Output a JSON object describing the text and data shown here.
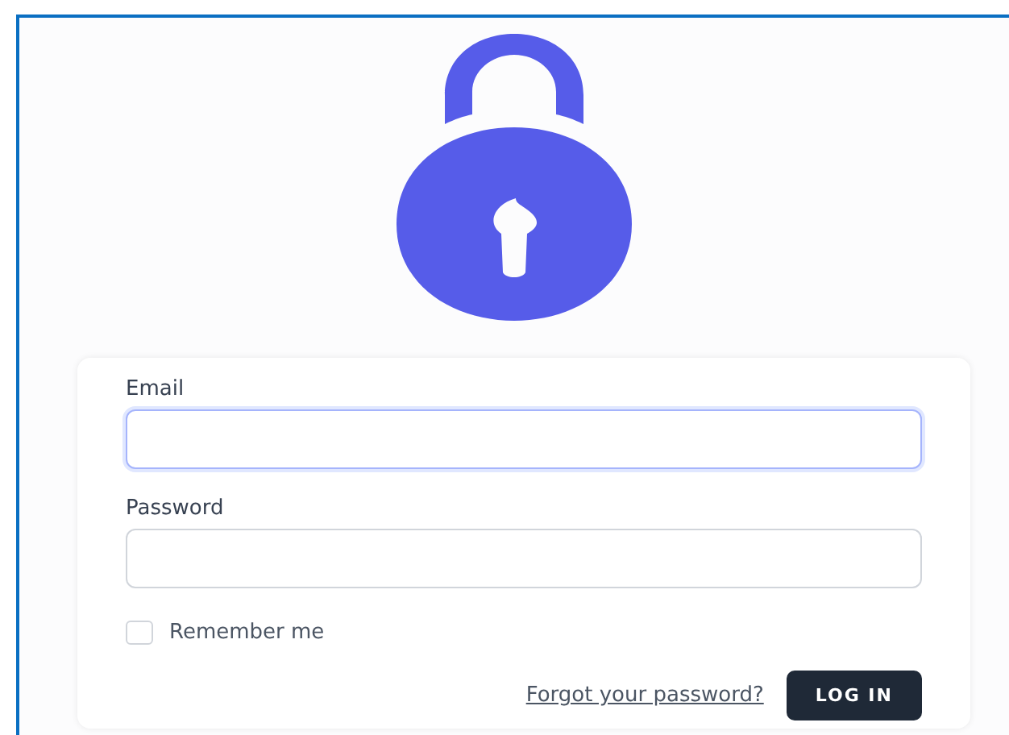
{
  "form": {
    "fields": [
      {
        "label": "Email",
        "focused": true
      },
      {
        "label": "Password",
        "focused": false
      }
    ],
    "remember": {
      "label": "Remember me",
      "checked": false
    },
    "forgot_link": "Forgot your password?",
    "submit": "LOG IN"
  }
}
